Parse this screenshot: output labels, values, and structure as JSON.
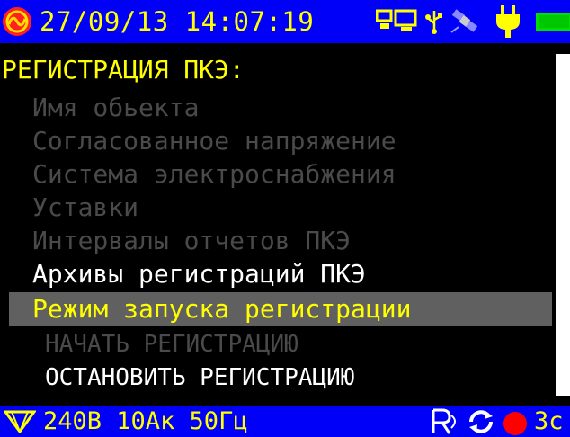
{
  "status": {
    "date": "27/09/13",
    "time": "14:07:19",
    "icons": [
      "power-logo-icon",
      "link-devices-icon",
      "usb-icon",
      "satellite-icon",
      "plug-icon",
      "battery-icon"
    ]
  },
  "menu": {
    "title": "РЕГИСТРАЦИЯ ПКЭ:",
    "items": [
      {
        "label": "Имя обьекта",
        "state": "disabled"
      },
      {
        "label": "Согласованное напряжение",
        "state": "disabled"
      },
      {
        "label": "Система электроснабжения",
        "state": "disabled"
      },
      {
        "label": "Уставки",
        "state": "disabled"
      },
      {
        "label": "Интервалы отчетов ПКЭ",
        "state": "disabled"
      },
      {
        "label": "Архивы регистраций ПКЭ",
        "state": "enabled"
      },
      {
        "label": "Режим запуска регистрации",
        "state": "selected"
      }
    ],
    "subitems": [
      {
        "label": "НАЧАТЬ РЕГИСТРАЦИЮ",
        "state": "disabled"
      },
      {
        "label": "ОСТАНОВИТЬ РЕГИСТРАЦИЮ",
        "state": "enabled"
      }
    ]
  },
  "bottom": {
    "status": "240В 10Ак 50Гц",
    "rec_time": "3с",
    "icons": [
      "filter-triangle-icon",
      "recording-icon",
      "sync-icon",
      "record-dot-icon"
    ]
  },
  "colors": {
    "bar": "#0000f8",
    "accent": "#ffff00",
    "highlight": "#606060",
    "disabled": "#4a4a4a"
  }
}
